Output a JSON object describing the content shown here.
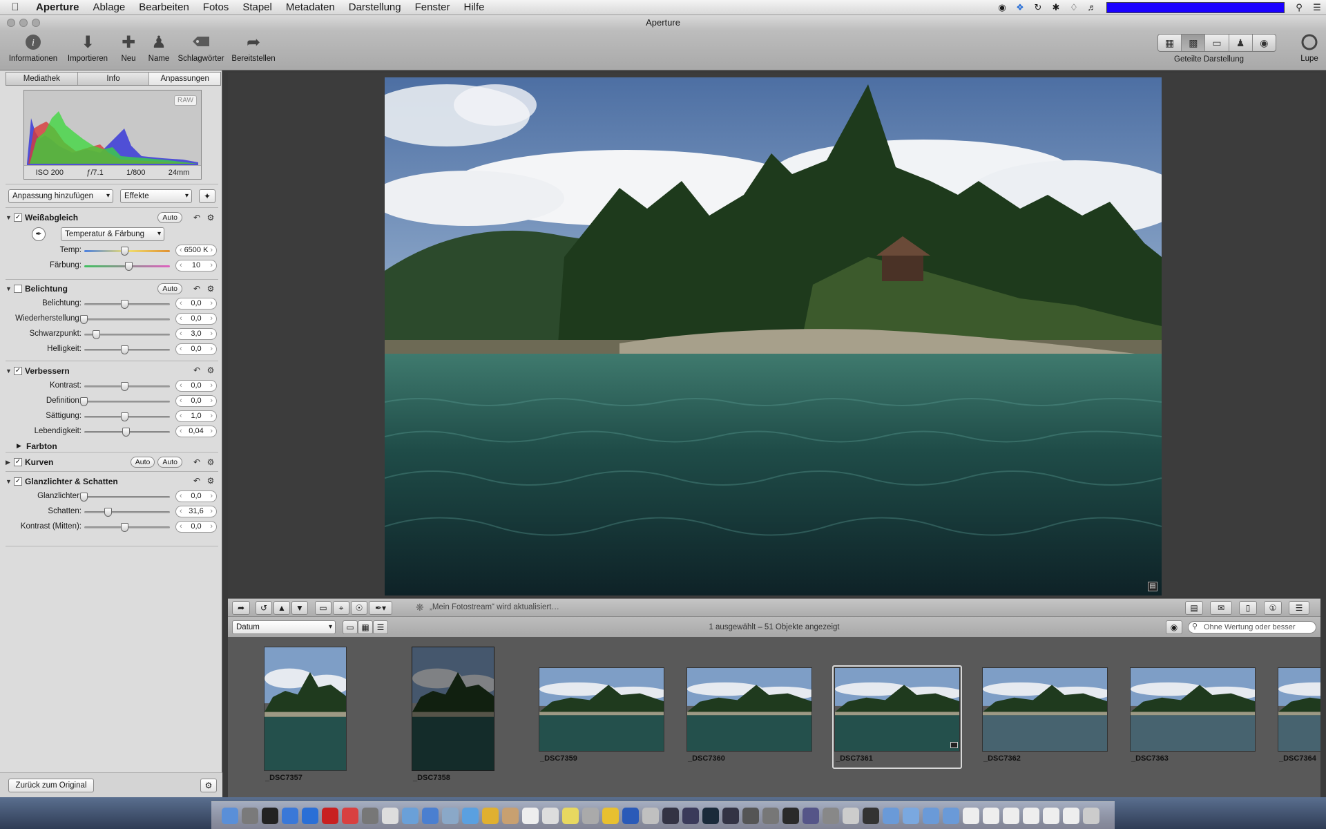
{
  "menubar": {
    "app_name": "Aperture",
    "items": [
      "Ablage",
      "Bearbeiten",
      "Fotos",
      "Stapel",
      "Metadaten",
      "Darstellung",
      "Fenster",
      "Hilfe"
    ]
  },
  "window": {
    "title": "Aperture"
  },
  "toolbar": {
    "buttons": [
      "Informationen",
      "Importieren",
      "Neu",
      "Name",
      "Schlagwörter",
      "Bereitstellen"
    ],
    "view_label": "Geteilte Darstellung",
    "loupe_label": "Lupe"
  },
  "inspector": {
    "tabs": [
      "Mediathek",
      "Info",
      "Anpassungen"
    ],
    "active_tab": "Anpassungen",
    "histogram": {
      "badge": "RAW",
      "iso": "ISO 200",
      "aperture": "ƒ/7.1",
      "shutter": "1/800",
      "focal": "24mm"
    },
    "add_adjustment": "Anpassung hinzufügen",
    "effects": "Effekte",
    "white_balance": {
      "title": "Weißabgleich",
      "auto": "Auto",
      "mode": "Temperatur & Färbung",
      "rows": [
        {
          "label": "Temp:",
          "value": "6500 K",
          "pos": 0.5
        },
        {
          "label": "Färbung:",
          "value": "10",
          "pos": 0.55
        }
      ]
    },
    "exposure": {
      "title": "Belichtung",
      "auto": "Auto",
      "rows": [
        {
          "label": "Belichtung:",
          "value": "0,0",
          "pos": 0.5
        },
        {
          "label": "Wiederherstellung:",
          "value": "0,0",
          "pos": 0.0
        },
        {
          "label": "Schwarzpunkt:",
          "value": "3,0",
          "pos": 0.15
        },
        {
          "label": "Helligkeit:",
          "value": "0,0",
          "pos": 0.5
        }
      ]
    },
    "enhance": {
      "title": "Verbessern",
      "rows": [
        {
          "label": "Kontrast:",
          "value": "0,0",
          "pos": 0.5
        },
        {
          "label": "Definition:",
          "value": "0,0",
          "pos": 0.0
        },
        {
          "label": "Sättigung:",
          "value": "1,0",
          "pos": 0.5
        },
        {
          "label": "Lebendigkeit:",
          "value": "0,04",
          "pos": 0.52
        }
      ],
      "tint": "Farbton"
    },
    "curves": {
      "title": "Kurven",
      "auto1": "Auto",
      "auto2": "Auto"
    },
    "highlights_shadows": {
      "title": "Glanzlichter & Schatten",
      "rows": [
        {
          "label": "Glanzlichter:",
          "value": "0,0",
          "pos": 0.0
        },
        {
          "label": "Schatten:",
          "value": "31,6",
          "pos": 0.3
        },
        {
          "label": "Kontrast (Mitten):",
          "value": "0,0",
          "pos": 0.5
        }
      ]
    },
    "revert_button": "Zurück zum Original"
  },
  "controlbar": {
    "status": "„Mein Fotostream“ wird aktualisiert…"
  },
  "browser": {
    "sort": "Datum",
    "count_text": "1 ausgewählt – 51 Objekte angezeigt",
    "filter_placeholder": "Ohne Wertung oder besser"
  },
  "filmstrip": [
    {
      "name": "_DSC7357",
      "orientation": "portrait"
    },
    {
      "name": "_DSC7358",
      "orientation": "portrait"
    },
    {
      "name": "_DSC7359",
      "orientation": "landscape"
    },
    {
      "name": "_DSC7360",
      "orientation": "landscape"
    },
    {
      "name": "_DSC7361",
      "orientation": "landscape",
      "selected": true
    },
    {
      "name": "_DSC7362",
      "orientation": "landscape"
    },
    {
      "name": "_DSC7363",
      "orientation": "landscape"
    },
    {
      "name": "_DSC7364",
      "orientation": "landscape"
    }
  ]
}
